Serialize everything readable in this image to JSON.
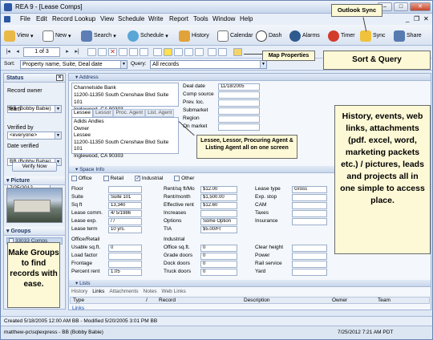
{
  "window": {
    "title": "REA 9 - [Lease Comps]",
    "min": "–",
    "max": "□",
    "close": "✕",
    "inner_min": "_",
    "inner_max": "❐",
    "inner_close": "✕"
  },
  "menu": [
    "File",
    "Edit",
    "Record",
    "Lookup",
    "View",
    "Schedule",
    "Write",
    "Report",
    "Tools",
    "Window",
    "Help"
  ],
  "toolbar": {
    "view": "View",
    "new": "New",
    "search": "Search",
    "schedule": "Schedule",
    "history": "History",
    "calendar": "Calendar",
    "dash": "Dash",
    "alarms": "Alarms",
    "timer": "Timer",
    "sync": "Sync",
    "share": "Share"
  },
  "nav": {
    "record_position": "1 of 3"
  },
  "sort": {
    "label": "Sort:",
    "value": "Property name, Suite, Deal date",
    "query_label": "Query:",
    "query_value": "All records"
  },
  "callouts": {
    "outlook_sync": "Outlook Sync",
    "map_properties": "Map Properties",
    "sort_query": "Sort & Query",
    "lessee_info": "Lessee, Lessor, Procuring Agent & Listing Agent all on one screen",
    "history": "History, events, web links, attachments (pdf. excel, word, marketing packets etc.) / pictures, leads and projects all in one simple to access place.",
    "groups": "Make Groups to find records with ease."
  },
  "left": {
    "status_head": "Status",
    "record_owner_label": "Record owner",
    "record_owner": "BB (Bobby Babie)",
    "team_label": "Team",
    "team": "<everyone>",
    "verified_by_label": "Verified by",
    "verified_by": "BB (Bobby Babie)",
    "date_verified_label": "Date verified",
    "date_verified": "7/25/2012",
    "verify_now": "Verify Now",
    "picture_head": "Picture",
    "groups_head": "Groups",
    "group_item": "33033 Comps"
  },
  "address": {
    "head": "Address",
    "lines": [
      "Channelside Bank",
      "11200-11350 South Crenshaw Blvd Suite 101",
      "Inglewood, CA 90303"
    ],
    "tabs": [
      "Lessee",
      "Lessor",
      "Proc. Agent",
      "List. Agent"
    ],
    "lessee_lines": [
      "Adids Andles",
      "Owner",
      "Lessee",
      "11200-11350 South Crenshaw Blvd Suite 101",
      "Inglewood, CA 90303"
    ],
    "deal_labels": [
      "Deal date",
      "Comp source",
      "Prev. loc.",
      "Submarket",
      "Region",
      "On market"
    ],
    "deal_date": "11/18/2005"
  },
  "space": {
    "head": "Space Info",
    "types": [
      "Office",
      "Retail",
      "Industrial",
      "Other"
    ],
    "col1_labels": [
      "Floor",
      "Suite",
      "Sq ft",
      "Lease comm.",
      "Lease exp.",
      "Lease term"
    ],
    "col1_values": [
      "",
      "Suite 101",
      "13,340",
      "4/ 5/1986",
      " /  /",
      "10 yrs."
    ],
    "col2_labels": [
      "Rent/sq ft/Mo",
      "Rent/month",
      "Effective rent",
      "Increases",
      "Options",
      "TIA"
    ],
    "col2_values": [
      "$12.00",
      "$1,500.00",
      "$12.60",
      "",
      "Some Option",
      "$5.00/Ft"
    ],
    "col3_labels": [
      "Lease type",
      "Exp. stop",
      "CAM",
      "Taxes",
      "Insurance"
    ],
    "col3_values": [
      "Gross",
      "",
      "",
      "",
      ""
    ],
    "office_retail": "Office/Retail",
    "industrial": "Industrial",
    "or_labels": [
      "Usable sq.ft.",
      "Load factor",
      "Frontage",
      "Percent rent"
    ],
    "or_values": [
      "0",
      "",
      "",
      "1.05"
    ],
    "ind_labels": [
      "Office sq.ft.",
      "Grade doors",
      "Dock doors",
      "Truck doors"
    ],
    "ind_values": [
      "0",
      "0",
      "0",
      "0"
    ],
    "misc_labels": [
      "Clear height",
      "Power",
      "Rail service",
      "Yard"
    ]
  },
  "lists": {
    "head": "Lists",
    "tabs": [
      "History",
      "Links",
      "Attachments",
      "Notes",
      "Web Links"
    ],
    "columns": [
      "Type",
      "/",
      "Record",
      "Description",
      "Owner",
      "Team"
    ],
    "row": "Links"
  },
  "status": {
    "created": "Created 5/18/2005 12:00 AM BB - Modified 5/20/2005 3:01 PM BB",
    "connection": "matthew-pc\\sqlexpress - BB (Bobby Babie)",
    "datetime": "7/25/2012 7:21 AM PDT"
  },
  "colors": {
    "accent": "#2d57a3",
    "callout": "#fdf9d6",
    "panel": "#eaf0f8"
  }
}
